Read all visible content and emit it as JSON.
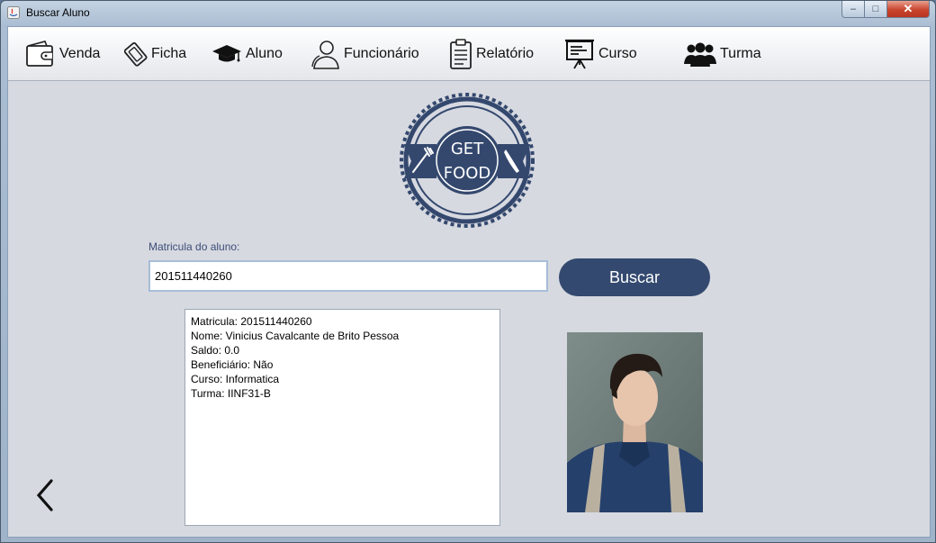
{
  "window": {
    "title": "Buscar Aluno",
    "controls": {
      "minimize": "‒",
      "maximize": "□",
      "close": "✕"
    }
  },
  "toolbar": {
    "items": [
      {
        "label": "Venda",
        "icon": "wallet-icon"
      },
      {
        "label": "Ficha",
        "icon": "ticket-icon"
      },
      {
        "label": "Aluno",
        "icon": "graduation-cap-icon"
      },
      {
        "label": "Funcionário",
        "icon": "person-icon"
      },
      {
        "label": "Relatório",
        "icon": "clipboard-icon"
      },
      {
        "label": "Curso",
        "icon": "presentation-board-icon"
      },
      {
        "label": "Turma",
        "icon": "people-group-icon"
      }
    ]
  },
  "logo": {
    "line1": "GET",
    "line2": "FOOD"
  },
  "search": {
    "label": "Matricula do aluno:",
    "value": "201511440260",
    "button": "Buscar"
  },
  "student": {
    "lines": [
      "Matricula: 201511440260",
      "Nome: Vinicius Cavalcante de Brito Pessoa",
      "Saldo: 0.0",
      "Beneficiário: Não",
      "Curso: Informatica",
      "Turma: IINF31-B"
    ]
  },
  "colors": {
    "accent": "#33496f",
    "background": "#d6d9e0",
    "label": "#3c4d78"
  },
  "back": {
    "icon": "chevron-left-icon"
  }
}
